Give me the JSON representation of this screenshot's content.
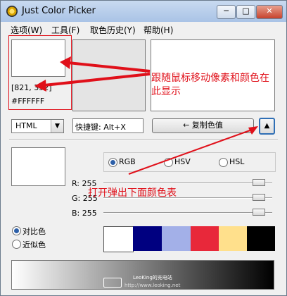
{
  "window": {
    "title": "Just Color Picker",
    "minimize": "─",
    "maximize": "□",
    "close": "✕"
  },
  "menu": [
    "选项(W)",
    "工具(F)",
    "取色历史(Y)",
    "帮助(H)"
  ],
  "picker": {
    "coords": "[821, 352]",
    "hex": "#FFFFFF"
  },
  "format": {
    "selected": "HTML"
  },
  "shortcut": {
    "label": "快捷键: Alt+X"
  },
  "copy_button": {
    "label": "← 复制色值"
  },
  "mode_options": [
    {
      "label": "RGB",
      "selected": true
    },
    {
      "label": "HSV",
      "selected": false
    },
    {
      "label": "HSL",
      "selected": false
    }
  ],
  "channels": [
    {
      "label": "R: 255",
      "value": 255
    },
    {
      "label": "G: 255",
      "value": 255
    },
    {
      "label": "B: 255",
      "value": 255
    }
  ],
  "scheme_options": [
    {
      "label": "对比色",
      "selected": true
    },
    {
      "label": "近似色",
      "selected": false
    }
  ],
  "swatches": [
    "#ffffff",
    "#000080",
    "#a3b0e8",
    "#e8283a",
    "#ffe08c",
    "#000000"
  ],
  "annotations": {
    "note_top_line1": "跟随鼠标移动像素和颜色在",
    "note_top_line2": "此显示",
    "note_bottom": "打开弹出下面颜色表"
  },
  "watermark": {
    "line1": "LeoKing的充电站",
    "line2": "http://www.leoking.net"
  },
  "colors": {
    "annotation": "#e0101a",
    "selected_radio": "#2c5fa8"
  }
}
